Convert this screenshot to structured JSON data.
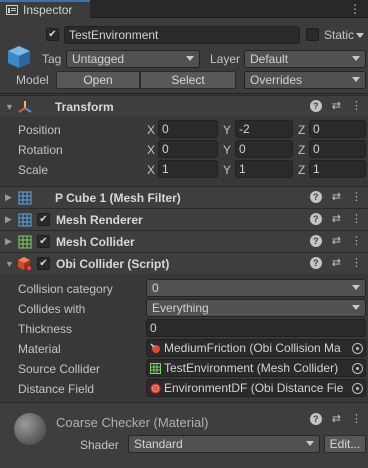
{
  "tab": {
    "title": "Inspector",
    "menu": "⋮"
  },
  "header": {
    "active": true,
    "name": "TestEnvironment",
    "static_label": "Static",
    "tag_label": "Tag",
    "tag_value": "Untagged",
    "layer_label": "Layer",
    "layer_value": "Default",
    "model_label": "Model",
    "open_label": "Open",
    "select_label": "Select",
    "overrides_value": "Overrides"
  },
  "transform": {
    "title": "Transform",
    "rows": [
      {
        "label": "Position",
        "x": "0",
        "y": "-2",
        "z": "0"
      },
      {
        "label": "Rotation",
        "x": "0",
        "y": "0",
        "z": "0"
      },
      {
        "label": "Scale",
        "x": "1",
        "y": "1",
        "z": "1"
      }
    ],
    "axis_x": "X",
    "axis_y": "Y",
    "axis_z": "Z"
  },
  "components": [
    {
      "title": "P Cube 1 (Mesh Filter)"
    },
    {
      "title": "Mesh Renderer"
    },
    {
      "title": "Mesh Collider"
    },
    {
      "title": "Obi Collider (Script)"
    }
  ],
  "obi": {
    "collision_category_label": "Collision category",
    "collision_category_value": "0",
    "collides_with_label": "Collides with",
    "collides_with_value": "Everything",
    "thickness_label": "Thickness",
    "thickness_value": "0",
    "material_label": "Material",
    "material_value": "MediumFriction (Obi Collision Ma",
    "source_collider_label": "Source Collider",
    "source_collider_value": "TestEnvironment (Mesh Collider)",
    "distance_field_label": "Distance Field",
    "distance_field_value": "EnvironmentDF (Obi Distance Fie"
  },
  "material": {
    "title": "Coarse Checker (Material)",
    "shader_label": "Shader",
    "shader_value": "Standard",
    "edit_label": "Edit..."
  },
  "colors": {
    "accent": "#3a72b0",
    "panel": "#383838",
    "header": "#3e3e3e",
    "field": "#2a2a2a"
  }
}
